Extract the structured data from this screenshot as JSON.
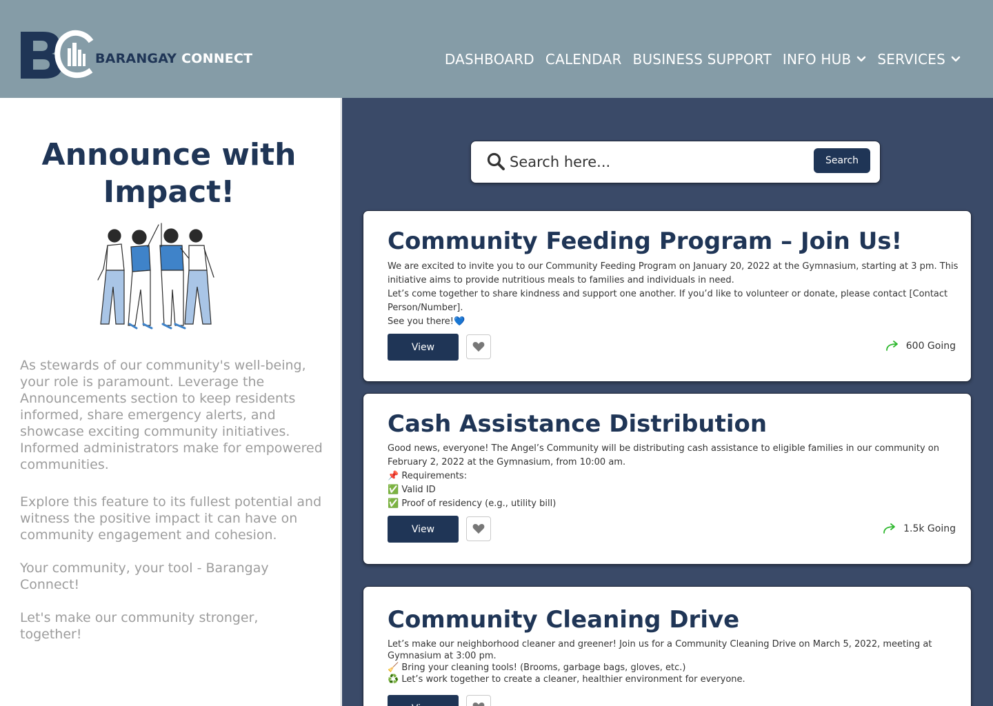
{
  "header": {
    "brand_word1": "BARANGAY",
    "brand_word2": "CONNECT",
    "nav": [
      {
        "label": "DASHBOARD"
      },
      {
        "label": "CALENDAR"
      },
      {
        "label": "BUSINESS SUPPORT"
      },
      {
        "label": "INFO HUB"
      },
      {
        "label": "SERVICES"
      }
    ]
  },
  "left": {
    "title_line1": "Announce with",
    "title_line2": "Impact!",
    "paragraphs": [
      "As stewards of our community's well-being, your role is paramount. Leverage the Announcements section to keep residents informed, share emergency alerts, and showcase exciting community initiatives. Informed administrators make for empowered communities.",
      "Explore this feature to its fullest potential and witness the positive impact it can have on community engagement and cohesion.",
      "Your community, your tool - Barangay Connect!",
      "Let's make our community stronger, together!"
    ]
  },
  "search": {
    "placeholder": "Search here...",
    "button": "Search"
  },
  "announcements": [
    {
      "title": "Community Feeding Program – Join Us!",
      "lines": [
        "We are excited to invite you to our Community Feeding Program on January 20, 2022 at the Gymnasium, starting at 3 pm. This initiative aims to provide nutritious meals to families and individuals in need.",
        "Let’s come together to share kindness and support one another. If you’d like to volunteer or donate, please contact [Contact Person/Number].",
        "See you there!💙"
      ],
      "view_label": "View",
      "going": "600 Going"
    },
    {
      "title": "Cash Assistance Distribution",
      "lines": [
        "Good news, everyone! The Angel’s Community will be distributing cash assistance to eligible families in our community on February 2, 2022 at the Gymnasium, from 10:00 am.",
        "📌 Requirements:",
        "✅ Valid ID",
        "✅ Proof of residency (e.g., utility bill)"
      ],
      "view_label": "View",
      "going": "1.5k Going"
    },
    {
      "title": "Community Cleaning Drive",
      "lines": [
        "Let’s make our neighborhood cleaner and greener! Join us for a Community Cleaning Drive on March 5, 2022, meeting at Gymnasium at 3:00 pm.",
        "🧹 Bring your cleaning tools! (Brooms, garbage bags, gloves, etc.)",
        "♻️ Let’s work together to create a cleaner, healthier environment for everyone."
      ],
      "view_label": "View",
      "going": ""
    }
  ]
}
